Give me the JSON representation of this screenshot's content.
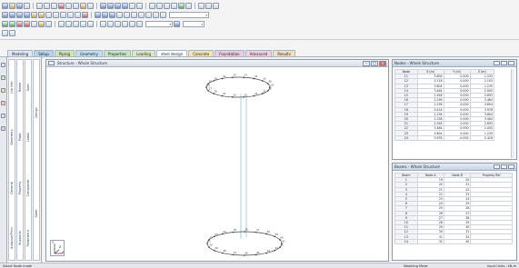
{
  "toolbar_combo1": "",
  "toolbar_combo2": "",
  "toolbar_combo3": "",
  "ribbon": {
    "tabs": [
      {
        "label": "Modeling",
        "bg": "#dfe8f6"
      },
      {
        "label": "Setup",
        "bg": "#b5d3ee"
      },
      {
        "label": "Piping",
        "bg": "#cfe6b0"
      },
      {
        "label": "Geometry",
        "bg": "#bcdff3"
      },
      {
        "label": "Properties",
        "bg": "#c6e7c0"
      },
      {
        "label": "Loading",
        "bg": "#d9ecc0"
      },
      {
        "label": "steel design",
        "bg": "#ffffff"
      },
      {
        "label": "Concrete",
        "bg": "#f5e6a8"
      },
      {
        "label": "Foundation",
        "bg": "#f3c9e0"
      },
      {
        "label": "Advanced",
        "bg": "#f6d0e2"
      },
      {
        "label": "Results",
        "bg": "#f7e2b8"
      }
    ]
  },
  "left_panel": {
    "col1": [
      {
        "label": "Job Info"
      },
      {
        "label": "Geometry"
      },
      {
        "label": "General"
      },
      {
        "label": "Analysis/Print"
      }
    ],
    "col2": [
      {
        "label": "Beam"
      },
      {
        "label": "Plate"
      },
      {
        "label": "Property"
      },
      {
        "label": "Supports"
      }
    ],
    "col3": [
      {
        "label": "Spec"
      },
      {
        "label": "Loads"
      },
      {
        "label": "Composite"
      },
      {
        "label": "Parametric"
      }
    ],
    "col4": [
      {
        "label": "Design"
      },
      {
        "label": "Steel"
      }
    ]
  },
  "viewport": {
    "title": "Structure - Whole Structure",
    "min": "–",
    "max": "□",
    "close": "×",
    "axis_y": "Y",
    "axis_z": "Z",
    "axis_x": "X"
  },
  "node_panel": {
    "title": "Nodes - Whole Structure",
    "headers": [
      "Node",
      "X (m)",
      "Y (m)",
      "Z (m)"
    ],
    "rows": [
      [
        "11",
        "3.804",
        "0.000",
        "1.235"
      ],
      [
        "12",
        "-3.118",
        "0.000",
        "2.103"
      ],
      [
        "13",
        "3.804",
        "0.000",
        "1.235"
      ],
      [
        "14",
        "3.464",
        "0.000",
        "2.000"
      ],
      [
        "15",
        "2.928",
        "0.000",
        "2.693"
      ],
      [
        "16",
        "2.236",
        "0.000",
        "3.464"
      ],
      [
        "17",
        "1.236",
        "0.000",
        "3.804"
      ],
      [
        "18",
        "0.418",
        "0.000",
        "3.978"
      ],
      [
        "19",
        "1.236",
        "0.000",
        "3.804"
      ],
      [
        "20",
        "2.236",
        "0.000",
        "3.464"
      ],
      [
        "21",
        "2.928",
        "0.000",
        "2.693"
      ],
      [
        "22",
        "3.464",
        "0.000",
        "2.000"
      ],
      [
        "23",
        "3.804",
        "0.000",
        "1.235"
      ],
      [
        "24",
        "3.978",
        "-0.000",
        "0.418"
      ]
    ]
  },
  "beam_panel": {
    "title": "Beams - Whole Structure",
    "headers": [
      "Beam",
      "Node A",
      "Node B",
      "Property Ref"
    ],
    "rows": [
      [
        "1",
        "19",
        "20",
        ""
      ],
      [
        "2",
        "20",
        "21",
        ""
      ],
      [
        "3",
        "21",
        "22",
        ""
      ],
      [
        "4",
        "22",
        "23",
        ""
      ],
      [
        "5",
        "23",
        "24",
        ""
      ],
      [
        "6",
        "24",
        "25",
        ""
      ],
      [
        "7",
        "25",
        "26",
        ""
      ],
      [
        "8",
        "26",
        "27",
        ""
      ],
      [
        "9",
        "27",
        "28",
        ""
      ],
      [
        "10",
        "28",
        "29",
        ""
      ],
      [
        "11",
        "29",
        "30",
        ""
      ],
      [
        "12",
        "30",
        "31",
        ""
      ],
      [
        "13",
        "31",
        "32",
        ""
      ],
      [
        "14",
        "32",
        "40",
        ""
      ]
    ]
  },
  "status": {
    "left": "Select Node mode",
    "center": "Modeling Mode",
    "right": "Input Units : kN-m"
  }
}
